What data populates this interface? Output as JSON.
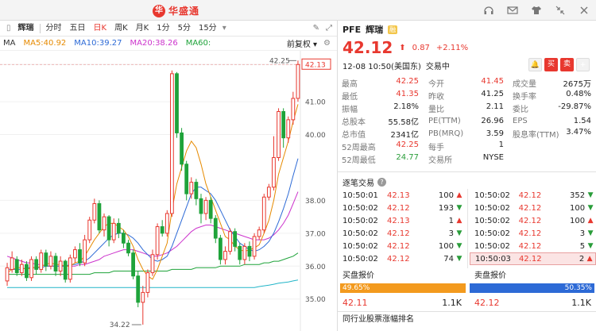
{
  "window": {
    "brand": "华盛通",
    "brand_mark": "华",
    "title_icons": [
      "headset-icon",
      "mail-icon",
      "shirt-icon",
      "collapse-icon",
      "close-icon"
    ]
  },
  "toolbar": {
    "stock_name": "辉瑞",
    "periods": [
      "分时",
      "五日",
      "日K",
      "周K",
      "月K",
      "1分",
      "5分",
      "15分"
    ],
    "active_period": "日K"
  },
  "ma": {
    "label": "MA",
    "ma5": "MA5:40.92",
    "ma10": "MA10:39.27",
    "ma20": "MA20:38.26",
    "ma60": "MA60:",
    "adjust": "前复权",
    "colors": {
      "ma5": "#e68a00",
      "ma10": "#2d6ad6",
      "ma20": "#cc33cc",
      "ma60": "#1fa33a"
    }
  },
  "chart_data": {
    "type": "candlestick",
    "y_ticks": [
      "42.13",
      "41.00",
      "40.00",
      "38.00",
      "37.00",
      "36.00",
      "35.00"
    ],
    "y_tick_values": [
      42.13,
      41,
      40,
      38,
      37,
      36,
      35
    ],
    "high_label": "42.25",
    "low_label": "34.22",
    "current_price_label": "42.13",
    "up_color": "#e8382f",
    "down_color": "#1fa33a",
    "ylim": [
      34.1,
      42.45
    ],
    "candles": [
      {
        "o": 35.55,
        "c": 35.95,
        "h": 36.1,
        "l": 35.4
      },
      {
        "o": 35.9,
        "c": 36.25,
        "h": 36.45,
        "l": 35.8
      },
      {
        "o": 36.2,
        "c": 35.8,
        "h": 36.3,
        "l": 35.7
      },
      {
        "o": 35.8,
        "c": 36.05,
        "h": 36.2,
        "l": 35.7
      },
      {
        "o": 36.05,
        "c": 35.65,
        "h": 36.15,
        "l": 35.55
      },
      {
        "o": 35.65,
        "c": 36.2,
        "h": 36.3,
        "l": 35.55
      },
      {
        "o": 36.2,
        "c": 35.9,
        "h": 36.3,
        "l": 35.75
      },
      {
        "o": 35.9,
        "c": 36.4,
        "h": 36.5,
        "l": 35.8
      },
      {
        "o": 36.4,
        "c": 36.0,
        "h": 36.5,
        "l": 35.85
      },
      {
        "o": 36.0,
        "c": 36.3,
        "h": 36.45,
        "l": 35.9
      },
      {
        "o": 36.3,
        "c": 35.85,
        "h": 36.4,
        "l": 35.7
      },
      {
        "o": 35.85,
        "c": 36.15,
        "h": 36.3,
        "l": 35.7
      },
      {
        "o": 36.15,
        "c": 35.6,
        "h": 36.2,
        "l": 35.5
      },
      {
        "o": 35.6,
        "c": 36.25,
        "h": 36.35,
        "l": 35.5
      },
      {
        "o": 36.25,
        "c": 36.5,
        "h": 36.6,
        "l": 36.1
      },
      {
        "o": 36.5,
        "c": 36.1,
        "h": 36.7,
        "l": 36.0
      },
      {
        "o": 36.1,
        "c": 36.8,
        "h": 36.95,
        "l": 36.0
      },
      {
        "o": 36.8,
        "c": 37.4,
        "h": 37.5,
        "l": 36.7
      },
      {
        "o": 37.4,
        "c": 37.9,
        "h": 38.05,
        "l": 37.3
      },
      {
        "o": 37.9,
        "c": 37.1,
        "h": 38.0,
        "l": 37.0
      },
      {
        "o": 37.1,
        "c": 37.5,
        "h": 37.6,
        "l": 36.9
      },
      {
        "o": 37.5,
        "c": 36.8,
        "h": 37.55,
        "l": 36.6
      },
      {
        "o": 36.8,
        "c": 37.3,
        "h": 37.45,
        "l": 36.7
      },
      {
        "o": 37.3,
        "c": 37.0,
        "h": 37.45,
        "l": 36.85
      },
      {
        "o": 37.0,
        "c": 36.7,
        "h": 37.1,
        "l": 36.55
      },
      {
        "o": 36.7,
        "c": 36.4,
        "h": 36.8,
        "l": 36.3
      },
      {
        "o": 36.4,
        "c": 35.7,
        "h": 36.5,
        "l": 35.6
      },
      {
        "o": 35.7,
        "c": 34.9,
        "h": 35.85,
        "l": 34.75
      },
      {
        "o": 34.9,
        "c": 35.2,
        "h": 35.4,
        "l": 34.22
      },
      {
        "o": 35.2,
        "c": 35.8,
        "h": 35.9,
        "l": 35.05
      },
      {
        "o": 35.8,
        "c": 36.35,
        "h": 36.5,
        "l": 35.7
      },
      {
        "o": 36.35,
        "c": 37.2,
        "h": 37.3,
        "l": 36.2
      },
      {
        "o": 37.2,
        "c": 37.0,
        "h": 37.4,
        "l": 36.9
      },
      {
        "o": 37.0,
        "c": 37.6,
        "h": 37.7,
        "l": 36.9
      },
      {
        "o": 37.6,
        "c": 41.85,
        "h": 41.95,
        "l": 37.5
      },
      {
        "o": 41.85,
        "c": 40.05,
        "h": 41.9,
        "l": 39.9
      },
      {
        "o": 40.05,
        "c": 39.1,
        "h": 40.2,
        "l": 38.9
      },
      {
        "o": 39.1,
        "c": 38.2,
        "h": 39.2,
        "l": 38.0
      },
      {
        "o": 38.2,
        "c": 38.55,
        "h": 38.7,
        "l": 38.05
      },
      {
        "o": 38.55,
        "c": 38.05,
        "h": 38.65,
        "l": 37.85
      },
      {
        "o": 38.05,
        "c": 37.6,
        "h": 38.2,
        "l": 37.3
      },
      {
        "o": 37.6,
        "c": 38.0,
        "h": 38.1,
        "l": 37.4
      },
      {
        "o": 38.0,
        "c": 37.45,
        "h": 38.1,
        "l": 37.3
      },
      {
        "o": 37.45,
        "c": 36.85,
        "h": 37.55,
        "l": 36.7
      },
      {
        "o": 36.85,
        "c": 36.2,
        "h": 36.95,
        "l": 36.05
      },
      {
        "o": 36.2,
        "c": 36.45,
        "h": 36.6,
        "l": 36.05
      },
      {
        "o": 36.45,
        "c": 37.05,
        "h": 37.15,
        "l": 36.35
      },
      {
        "o": 37.05,
        "c": 36.6,
        "h": 37.15,
        "l": 36.45
      },
      {
        "o": 36.6,
        "c": 36.2,
        "h": 36.7,
        "l": 36.05
      },
      {
        "o": 36.2,
        "c": 36.6,
        "h": 36.7,
        "l": 36.05
      },
      {
        "o": 36.6,
        "c": 36.3,
        "h": 36.75,
        "l": 36.15
      },
      {
        "o": 36.3,
        "c": 36.9,
        "h": 37.0,
        "l": 36.2
      },
      {
        "o": 36.9,
        "c": 37.1,
        "h": 37.2,
        "l": 36.8
      },
      {
        "o": 37.1,
        "c": 38.1,
        "h": 38.2,
        "l": 37.0
      },
      {
        "o": 38.1,
        "c": 38.4,
        "h": 38.5,
        "l": 38.0
      },
      {
        "o": 38.4,
        "c": 39.3,
        "h": 39.95,
        "l": 38.3
      },
      {
        "o": 39.3,
        "c": 40.7,
        "h": 40.8,
        "l": 39.2
      },
      {
        "o": 40.7,
        "c": 39.9,
        "h": 40.8,
        "l": 39.6
      },
      {
        "o": 39.9,
        "c": 40.45,
        "h": 40.55,
        "l": 39.75
      },
      {
        "o": 40.45,
        "c": 41.1,
        "h": 41.3,
        "l": 40.3
      },
      {
        "o": 41.1,
        "c": 42.13,
        "h": 42.25,
        "l": 41.0
      }
    ],
    "ma_lines": {
      "ma5": [
        35.8,
        35.9,
        35.95,
        35.95,
        35.9,
        35.95,
        35.95,
        36.0,
        36.05,
        36.1,
        36.05,
        36.05,
        36.0,
        36.0,
        36.1,
        36.15,
        36.3,
        36.55,
        36.8,
        37.0,
        37.2,
        37.3,
        37.3,
        37.2,
        37.1,
        36.9,
        36.6,
        36.2,
        35.9,
        35.7,
        35.6,
        35.9,
        36.3,
        36.7,
        37.7,
        38.5,
        39.0,
        39.5,
        39.8,
        39.6,
        39.1,
        38.5,
        38.1,
        37.7,
        37.3,
        36.9,
        36.8,
        36.6,
        36.5,
        36.45,
        36.5,
        36.55,
        36.65,
        37.0,
        37.4,
        38.0,
        38.8,
        39.3,
        39.8,
        40.4,
        40.92
      ],
      "ma10": [
        35.9,
        35.9,
        35.9,
        35.9,
        35.95,
        35.95,
        35.95,
        35.95,
        36.0,
        36.0,
        36.0,
        36.0,
        36.0,
        36.05,
        36.05,
        36.1,
        36.15,
        36.25,
        36.4,
        36.55,
        36.7,
        36.85,
        36.95,
        37.0,
        37.0,
        36.95,
        36.85,
        36.7,
        36.5,
        36.35,
        36.2,
        36.15,
        36.2,
        36.3,
        36.6,
        37.0,
        37.4,
        37.8,
        38.2,
        38.4,
        38.4,
        38.3,
        38.2,
        38.0,
        37.7,
        37.4,
        37.1,
        36.9,
        36.7,
        36.6,
        36.5,
        36.45,
        36.5,
        36.6,
        36.75,
        37.0,
        37.35,
        37.75,
        38.2,
        38.75,
        39.27
      ],
      "ma20": [
        36.3,
        36.25,
        36.2,
        36.15,
        36.1,
        36.1,
        36.05,
        36.05,
        36.0,
        36.0,
        36.0,
        36.0,
        36.0,
        36.0,
        36.0,
        36.05,
        36.05,
        36.1,
        36.15,
        36.2,
        36.3,
        36.35,
        36.4,
        36.45,
        36.5,
        36.5,
        36.5,
        36.45,
        36.4,
        36.35,
        36.3,
        36.3,
        36.35,
        36.4,
        36.5,
        36.6,
        36.75,
        36.9,
        37.05,
        37.15,
        37.2,
        37.25,
        37.25,
        37.2,
        37.15,
        37.1,
        37.05,
        37.0,
        36.95,
        36.9,
        36.85,
        36.8,
        36.8,
        36.8,
        36.85,
        36.95,
        37.1,
        37.3,
        37.55,
        37.9,
        38.26
      ],
      "ma60": [
        35.75,
        35.75,
        35.75,
        35.75,
        35.75,
        35.75,
        35.75,
        35.75,
        35.75,
        35.75,
        35.75,
        35.75,
        35.75,
        35.75,
        35.75,
        35.75,
        35.75,
        35.75,
        35.8,
        35.8,
        35.8,
        35.8,
        35.85,
        35.85,
        35.85,
        35.85,
        35.85,
        35.85,
        35.85,
        35.85,
        35.85,
        35.85,
        35.85,
        35.85,
        35.9,
        35.9,
        35.9,
        35.9,
        35.9,
        35.95,
        35.95,
        35.95,
        35.95,
        35.95,
        36.0,
        36.0,
        36.0,
        36.0,
        36.0,
        36.05,
        36.05,
        36.05,
        36.05,
        36.1,
        36.1,
        36.15,
        36.15,
        36.2,
        36.25,
        36.3,
        36.4
      ]
    },
    "bottom_line": [
      35.35,
      35.35,
      35.35,
      35.35,
      35.35,
      35.35,
      35.35,
      35.35,
      35.35,
      35.35,
      35.35,
      35.35,
      35.35,
      35.35,
      35.35,
      35.35,
      35.35,
      35.35,
      35.35,
      35.35,
      35.35,
      35.35,
      35.35,
      35.35,
      35.35,
      35.35,
      35.35,
      35.35,
      35.35,
      35.35,
      35.35,
      35.35,
      35.35,
      35.35,
      35.35,
      35.35,
      35.35,
      35.35,
      35.35,
      35.35,
      35.35,
      35.35,
      35.35,
      35.35,
      35.35,
      35.35,
      35.35,
      35.35,
      35.35,
      35.35,
      35.35,
      35.35,
      35.38,
      35.4,
      35.42,
      35.45,
      35.48,
      35.5,
      35.52,
      35.55,
      35.58
    ]
  },
  "quote": {
    "code": "PFE",
    "name": "辉瑞",
    "badge": "融",
    "price": "42.12",
    "change": "0.87",
    "change_pct": "+2.11%",
    "time": "12-08  10:50(美国东)",
    "status": "交易中",
    "btn_buy": "买",
    "btn_sell": "卖",
    "btn_plus": "+"
  },
  "stats": [
    [
      {
        "l": "最高",
        "v": "42.25",
        "c": "red"
      },
      {
        "l": "今开",
        "v": "41.45",
        "c": "red"
      },
      {
        "l": "成交量",
        "v": "2675万",
        "c": "dark"
      }
    ],
    [
      {
        "l": "最低",
        "v": "41.35",
        "c": "red"
      },
      {
        "l": "昨收",
        "v": "41.25",
        "c": "dark"
      },
      {
        "l": "换手率",
        "v": "0.48%",
        "c": "dark"
      }
    ],
    [
      {
        "l": "振幅",
        "v": "2.18%",
        "c": "dark"
      },
      {
        "l": "量比",
        "v": "2.11",
        "c": "dark"
      },
      {
        "l": "委比",
        "v": "-29.87%",
        "c": "dark"
      }
    ],
    [
      {
        "l": "总股本",
        "v": "55.58亿",
        "c": "dark"
      },
      {
        "l": "PE(TTM)",
        "v": "26.96",
        "c": "dark"
      },
      {
        "l": "EPS",
        "v": "1.54",
        "c": "dark"
      }
    ],
    [
      {
        "l": "总市值",
        "v": "2341亿",
        "c": "dark"
      },
      {
        "l": "PB(MRQ)",
        "v": "3.59",
        "c": "dark"
      },
      {
        "l": "股息率(TTM)",
        "v": "3.47%",
        "c": "dark"
      }
    ],
    [
      {
        "l": "52周最高",
        "v": "42.25",
        "c": "red"
      },
      {
        "l": "每手",
        "v": "1",
        "c": "dark"
      },
      {
        "l": "",
        "v": "",
        "c": "dark"
      }
    ],
    [
      {
        "l": "52周最低",
        "v": "24.77",
        "c": "green"
      },
      {
        "l": "交易所",
        "v": "NYSE",
        "c": "dark"
      },
      {
        "l": "",
        "v": "",
        "c": "dark"
      }
    ]
  ],
  "trades": {
    "title": "逐笔交易",
    "help": "?",
    "left": [
      {
        "t": "10:50:01",
        "p": "42.13",
        "v": "100",
        "dir": "up"
      },
      {
        "t": "10:50:02",
        "p": "42.12",
        "v": "193",
        "dir": "down"
      },
      {
        "t": "10:50:02",
        "p": "42.13",
        "v": "1",
        "dir": "up"
      },
      {
        "t": "10:50:02",
        "p": "42.12",
        "v": "3",
        "dir": "down"
      },
      {
        "t": "10:50:02",
        "p": "42.12",
        "v": "100",
        "dir": "down"
      },
      {
        "t": "10:50:02",
        "p": "42.12",
        "v": "74",
        "dir": "down"
      }
    ],
    "right": [
      {
        "t": "10:50:02",
        "p": "42.12",
        "v": "352",
        "dir": "down"
      },
      {
        "t": "10:50:02",
        "p": "42.12",
        "v": "100",
        "dir": "down"
      },
      {
        "t": "10:50:02",
        "p": "42.12",
        "v": "100",
        "dir": "up"
      },
      {
        "t": "10:50:02",
        "p": "42.12",
        "v": "3",
        "dir": "down"
      },
      {
        "t": "10:50:02",
        "p": "42.12",
        "v": "5",
        "dir": "down"
      },
      {
        "t": "10:50:03",
        "p": "42.12",
        "v": "2",
        "dir": "up"
      }
    ]
  },
  "bidask": {
    "bid_label": "买盘报价",
    "ask_label": "卖盘报价",
    "bid_pct": "49.65%",
    "ask_pct": "50.35%",
    "bid_price": "42.11",
    "bid_vol": "1.1K",
    "ask_price": "42.12",
    "ask_vol": "1.1K"
  },
  "industry": {
    "title": "同行业股票涨幅排名"
  }
}
